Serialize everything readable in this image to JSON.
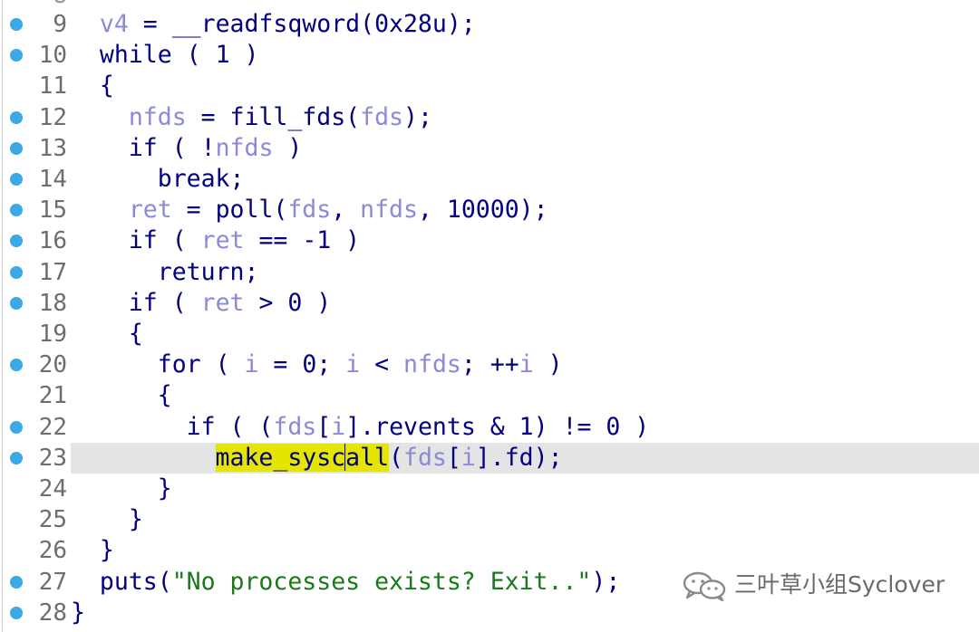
{
  "top_partial_line": "8",
  "breakpoint_color": "#3aa9e6",
  "highlight_color": "#e5e600",
  "lines": [
    {
      "num": "9",
      "bp": true,
      "indent": "  ",
      "tokens": [
        [
          "v",
          "v4"
        ],
        [
          "p",
          " = __readfsqword(0x28u);"
        ]
      ]
    },
    {
      "num": "10",
      "bp": true,
      "indent": "  ",
      "tokens": [
        [
          "kw",
          "while"
        ],
        [
          "p",
          " ( 1 )"
        ]
      ]
    },
    {
      "num": "11",
      "bp": false,
      "indent": "  ",
      "tokens": [
        [
          "p",
          "{"
        ]
      ]
    },
    {
      "num": "12",
      "bp": true,
      "indent": "    ",
      "tokens": [
        [
          "v",
          "nfds"
        ],
        [
          "p",
          " = fill_fds("
        ],
        [
          "v",
          "fds"
        ],
        [
          "p",
          ");"
        ]
      ]
    },
    {
      "num": "13",
      "bp": true,
      "indent": "    ",
      "tokens": [
        [
          "kw",
          "if"
        ],
        [
          "p",
          " ( !"
        ],
        [
          "v",
          "nfds"
        ],
        [
          "p",
          " )"
        ]
      ]
    },
    {
      "num": "14",
      "bp": true,
      "indent": "      ",
      "tokens": [
        [
          "kw",
          "break"
        ],
        [
          "p",
          ";"
        ]
      ]
    },
    {
      "num": "15",
      "bp": true,
      "indent": "    ",
      "tokens": [
        [
          "v",
          "ret"
        ],
        [
          "p",
          " = poll("
        ],
        [
          "v",
          "fds"
        ],
        [
          "p",
          ", "
        ],
        [
          "v",
          "nfds"
        ],
        [
          "p",
          ", 10000);"
        ]
      ]
    },
    {
      "num": "16",
      "bp": true,
      "indent": "    ",
      "tokens": [
        [
          "kw",
          "if"
        ],
        [
          "p",
          " ( "
        ],
        [
          "v",
          "ret"
        ],
        [
          "p",
          " == -1 )"
        ]
      ]
    },
    {
      "num": "17",
      "bp": true,
      "indent": "      ",
      "tokens": [
        [
          "kw",
          "return"
        ],
        [
          "p",
          ";"
        ]
      ]
    },
    {
      "num": "18",
      "bp": true,
      "indent": "    ",
      "tokens": [
        [
          "kw",
          "if"
        ],
        [
          "p",
          " ( "
        ],
        [
          "v",
          "ret"
        ],
        [
          "p",
          " > 0 )"
        ]
      ]
    },
    {
      "num": "19",
      "bp": false,
      "indent": "    ",
      "tokens": [
        [
          "p",
          "{"
        ]
      ]
    },
    {
      "num": "20",
      "bp": true,
      "indent": "      ",
      "tokens": [
        [
          "kw",
          "for"
        ],
        [
          "p",
          " ( "
        ],
        [
          "v",
          "i"
        ],
        [
          "p",
          " = 0; "
        ],
        [
          "v",
          "i"
        ],
        [
          "p",
          " < "
        ],
        [
          "v",
          "nfds"
        ],
        [
          "p",
          "; ++"
        ],
        [
          "v",
          "i"
        ],
        [
          "p",
          " )"
        ]
      ]
    },
    {
      "num": "21",
      "bp": false,
      "indent": "      ",
      "tokens": [
        [
          "p",
          "{"
        ]
      ]
    },
    {
      "num": "22",
      "bp": true,
      "indent": "        ",
      "tokens": [
        [
          "kw",
          "if"
        ],
        [
          "p",
          " ( ("
        ],
        [
          "v",
          "fds"
        ],
        [
          "p",
          "["
        ],
        [
          "v",
          "i"
        ],
        [
          "p",
          "].revents & 1) != 0 )"
        ]
      ]
    },
    {
      "num": "23",
      "bp": true,
      "current": true,
      "indent": "          ",
      "tokens": [
        [
          "find",
          "make_sysc"
        ],
        [
          "caret",
          ""
        ],
        [
          "find",
          "all"
        ],
        [
          "p",
          "("
        ],
        [
          "v",
          "fds"
        ],
        [
          "p",
          "["
        ],
        [
          "v",
          "i"
        ],
        [
          "p",
          "].fd);"
        ]
      ]
    },
    {
      "num": "24",
      "bp": false,
      "indent": "      ",
      "tokens": [
        [
          "p",
          "}"
        ]
      ]
    },
    {
      "num": "25",
      "bp": false,
      "indent": "    ",
      "tokens": [
        [
          "p",
          "}"
        ]
      ]
    },
    {
      "num": "26",
      "bp": false,
      "indent": "  ",
      "tokens": [
        [
          "p",
          "}"
        ]
      ]
    },
    {
      "num": "27",
      "bp": true,
      "indent": "  ",
      "tokens": [
        [
          "p",
          "puts("
        ],
        [
          "s",
          "\"No processes exists? Exit..\""
        ],
        [
          "p",
          ");"
        ]
      ]
    },
    {
      "num": "28",
      "bp": true,
      "indent": "",
      "tokens": [
        [
          "p",
          "}"
        ]
      ]
    }
  ],
  "watermark": {
    "icon": "wechat-icon",
    "text": "三叶草小组Syclover"
  }
}
